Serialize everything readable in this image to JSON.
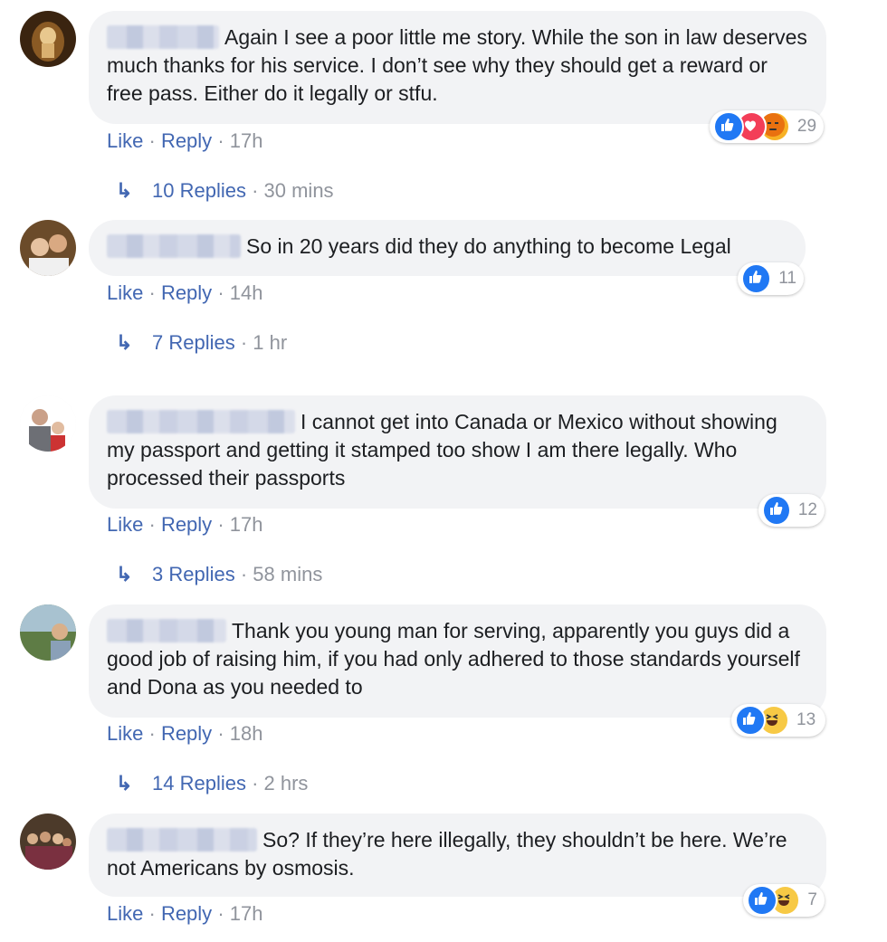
{
  "comments": [
    {
      "text": "Again I see a poor little me story. While the son in law deserves much thanks for his service. I don’t see why they should get a reward or free pass. Either do it legally or stfu.",
      "like": "Like",
      "reply": "Reply",
      "time": "17h",
      "reactions": [
        "like",
        "love",
        "angry"
      ],
      "reaction_count": "29",
      "replies_label": "10 Replies",
      "replies_time": "30 mins"
    },
    {
      "text": "So in 20 years did they do anything to become Legal",
      "like": "Like",
      "reply": "Reply",
      "time": "14h",
      "reactions": [
        "like"
      ],
      "reaction_count": "11",
      "replies_label": "7 Replies",
      "replies_time": "1 hr"
    },
    {
      "text": "I cannot get into Canada or Mexico without showing my passport and getting it stamped too show I am there legally. Who processed their passports",
      "like": "Like",
      "reply": "Reply",
      "time": "17h",
      "reactions": [
        "like"
      ],
      "reaction_count": "12",
      "replies_label": "3 Replies",
      "replies_time": "58 mins"
    },
    {
      "text": "Thank you young man for serving, apparently you guys did a good job of raising him, if you had only adhered to those standards yourself and Dona as you needed to",
      "like": "Like",
      "reply": "Reply",
      "time": "18h",
      "reactions": [
        "like",
        "haha"
      ],
      "reaction_count": "13",
      "replies_label": "14 Replies",
      "replies_time": "2 hrs"
    },
    {
      "text": "So? If they’re here illegally, they shouldn’t be here. We’re not Americans by osmosis.",
      "like": "Like",
      "reply": "Reply",
      "time": "17h",
      "reactions": [
        "like",
        "haha"
      ],
      "reaction_count": "7"
    }
  ],
  "colors": {
    "link": "#4267b2",
    "bubble": "#f2f3f5",
    "muted": "#90949c",
    "like": "#2078f4",
    "love": "#f33e58",
    "angry": "#f7b125",
    "haha": "#f7c945"
  }
}
